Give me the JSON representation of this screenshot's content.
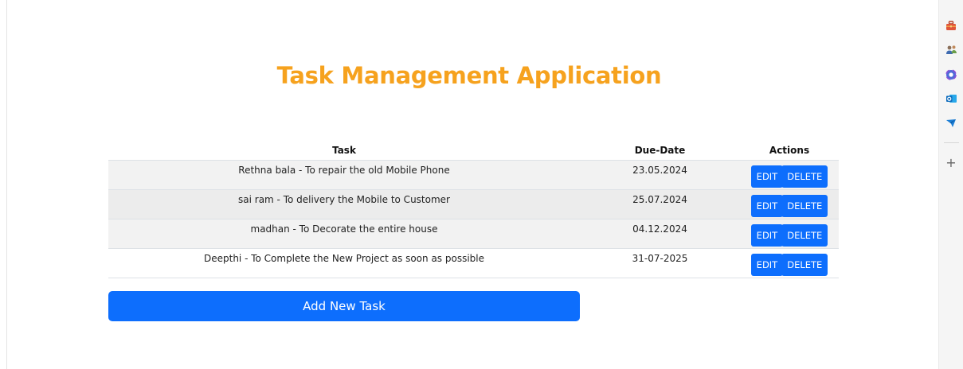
{
  "header": {
    "title": "Task Management Application"
  },
  "table": {
    "columns": [
      "Task",
      "Due-Date",
      "Actions"
    ],
    "rows": [
      {
        "task": "Rethna bala - To repair the old Mobile Phone",
        "due_date": "23.05.2024"
      },
      {
        "task": "sai ram - To delivery the Mobile to Customer",
        "due_date": "25.07.2024"
      },
      {
        "task": "madhan - To Decorate the entire house",
        "due_date": "04.12.2024"
      },
      {
        "task": "Deepthi - To Complete the New Project as soon as possible",
        "due_date": "31-07-2025"
      }
    ],
    "edit_label": "EDIT",
    "delete_label": "DELETE"
  },
  "actions": {
    "add_label": "Add New Task"
  },
  "sidebar": {
    "icons": [
      "toolbox-icon",
      "people-icon",
      "copilot-icon",
      "outlook-icon",
      "send-icon"
    ],
    "plus_label": "+"
  },
  "colors": {
    "title": "#f6a21e",
    "primary": "#0d6efd"
  }
}
